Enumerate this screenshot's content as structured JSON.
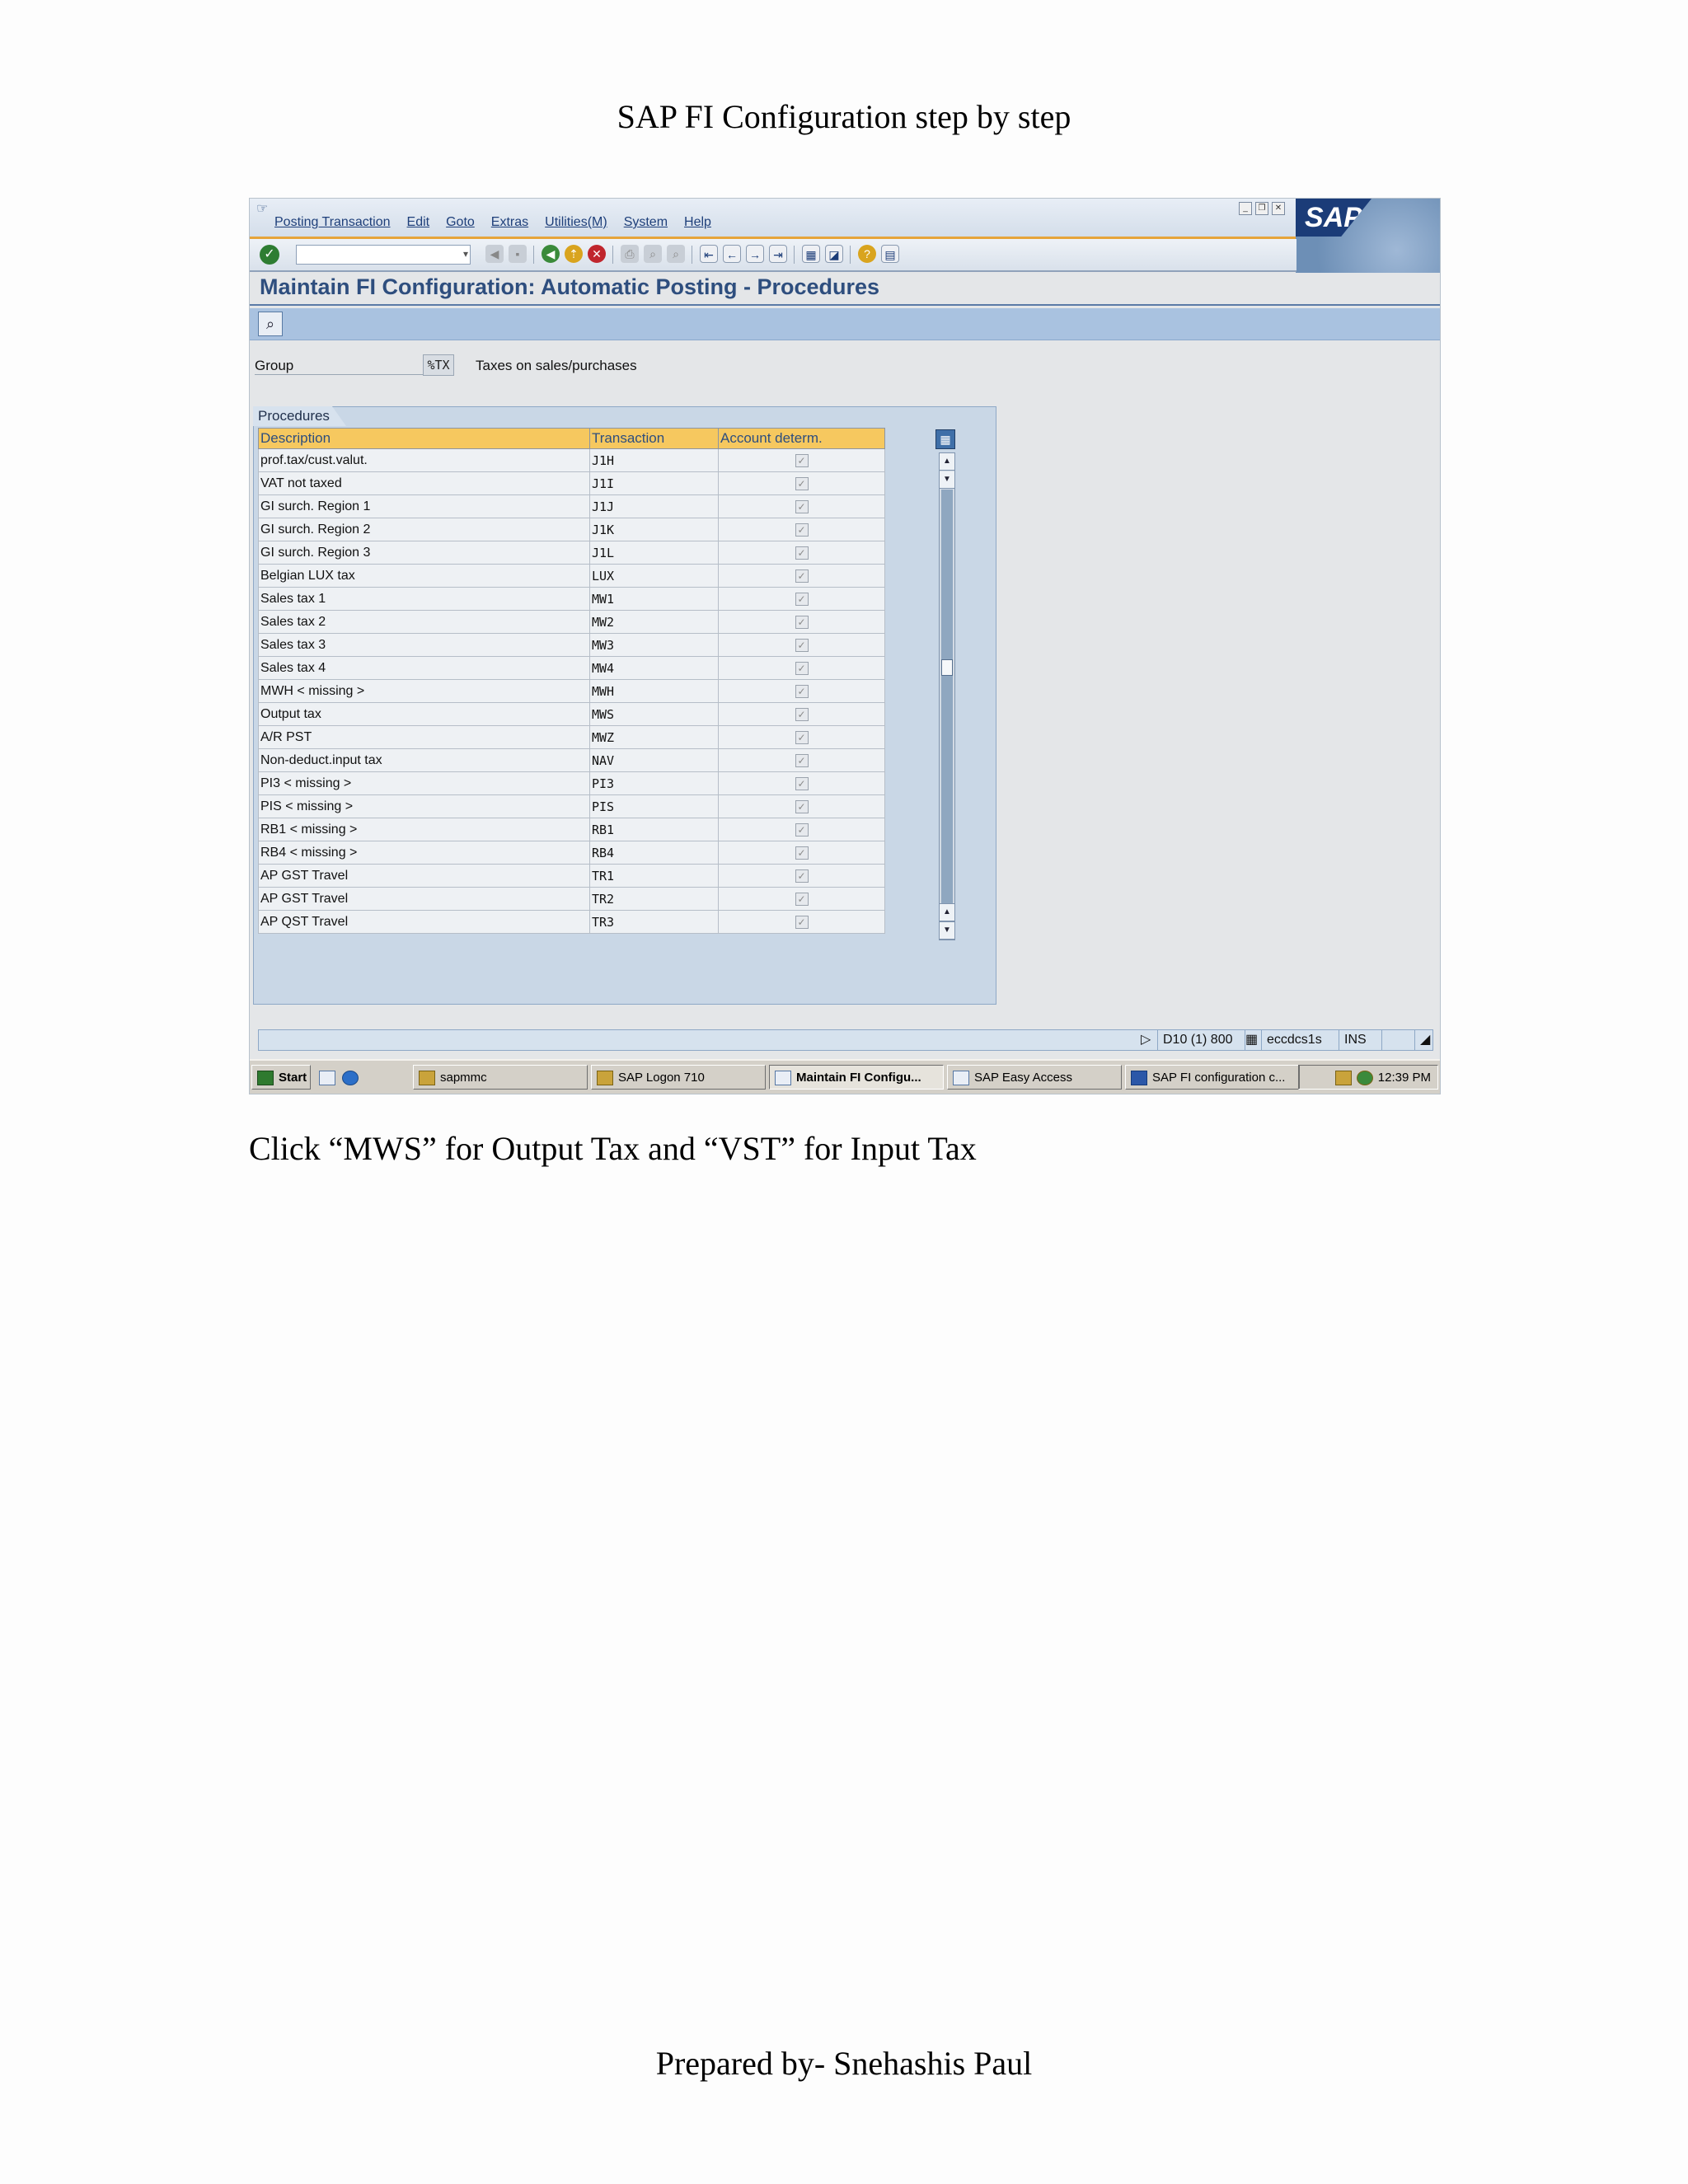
{
  "document": {
    "title": "SAP FI Configuration step by step",
    "caption": "Click “MWS” for Output Tax and “VST” for Input Tax",
    "footer": "Prepared by- Snehashis Paul"
  },
  "sap": {
    "menu": [
      "Posting Transaction",
      "Edit",
      "Goto",
      "Extras",
      "Utilities(M)",
      "System",
      "Help"
    ],
    "logo_text": "SAP",
    "screen_title": "Maintain FI Configuration: Automatic Posting - Procedures",
    "group": {
      "label": "Group",
      "value": "%TX",
      "description": "Taxes on sales/purchases"
    },
    "procedures": {
      "frame_title": "Procedures",
      "columns": [
        "Description",
        "Transaction",
        "Account determ."
      ],
      "rows": [
        {
          "description": "prof.tax/cust.valut.",
          "transaction": "J1H",
          "checked": true
        },
        {
          "description": "VAT not taxed",
          "transaction": "J1I",
          "checked": true
        },
        {
          "description": "GI surch. Region 1",
          "transaction": "J1J",
          "checked": true
        },
        {
          "description": "GI surch. Region 2",
          "transaction": "J1K",
          "checked": true
        },
        {
          "description": "GI surch. Region 3",
          "transaction": "J1L",
          "checked": true
        },
        {
          "description": "Belgian LUX tax",
          "transaction": "LUX",
          "checked": true
        },
        {
          "description": "Sales tax 1",
          "transaction": "MW1",
          "checked": true
        },
        {
          "description": "Sales tax 2",
          "transaction": "MW2",
          "checked": true
        },
        {
          "description": "Sales tax 3",
          "transaction": "MW3",
          "checked": true
        },
        {
          "description": "Sales tax 4",
          "transaction": "MW4",
          "checked": true
        },
        {
          "description": "MWH < missing >",
          "transaction": "MWH",
          "checked": true
        },
        {
          "description": "Output tax",
          "transaction": "MWS",
          "checked": true
        },
        {
          "description": "A/R PST",
          "transaction": "MWZ",
          "checked": true
        },
        {
          "description": "Non-deduct.input tax",
          "transaction": "NAV",
          "checked": true
        },
        {
          "description": "PI3 < missing >",
          "transaction": "PI3",
          "checked": true
        },
        {
          "description": "PIS < missing >",
          "transaction": "PIS",
          "checked": true
        },
        {
          "description": "RB1 < missing >",
          "transaction": "RB1",
          "checked": true
        },
        {
          "description": "RB4 < missing >",
          "transaction": "RB4",
          "checked": true
        },
        {
          "description": "AP GST Travel",
          "transaction": "TR1",
          "checked": true
        },
        {
          "description": "AP GST Travel",
          "transaction": "TR2",
          "checked": true
        },
        {
          "description": "AP  QST  Travel",
          "transaction": "TR3",
          "checked": true
        }
      ]
    },
    "status": {
      "system": "D10 (1) 800",
      "server": "eccdcs1s",
      "mode": "INS"
    }
  },
  "taskbar": {
    "start": "Start",
    "items": [
      {
        "label": "sapmmc",
        "active": false
      },
      {
        "label": "SAP Logon 710",
        "active": false
      },
      {
        "label": "Maintain FI Configu...",
        "active": true
      },
      {
        "label": "SAP Easy Access",
        "active": false
      },
      {
        "label": "SAP FI configuration c...",
        "active": false
      }
    ],
    "clock": "12:39 PM"
  },
  "icons": [
    "save-icon",
    "back-icon",
    "exit-icon",
    "cancel-icon",
    "print-icon",
    "find-icon",
    "help-icon",
    "table-settings-icon"
  ]
}
